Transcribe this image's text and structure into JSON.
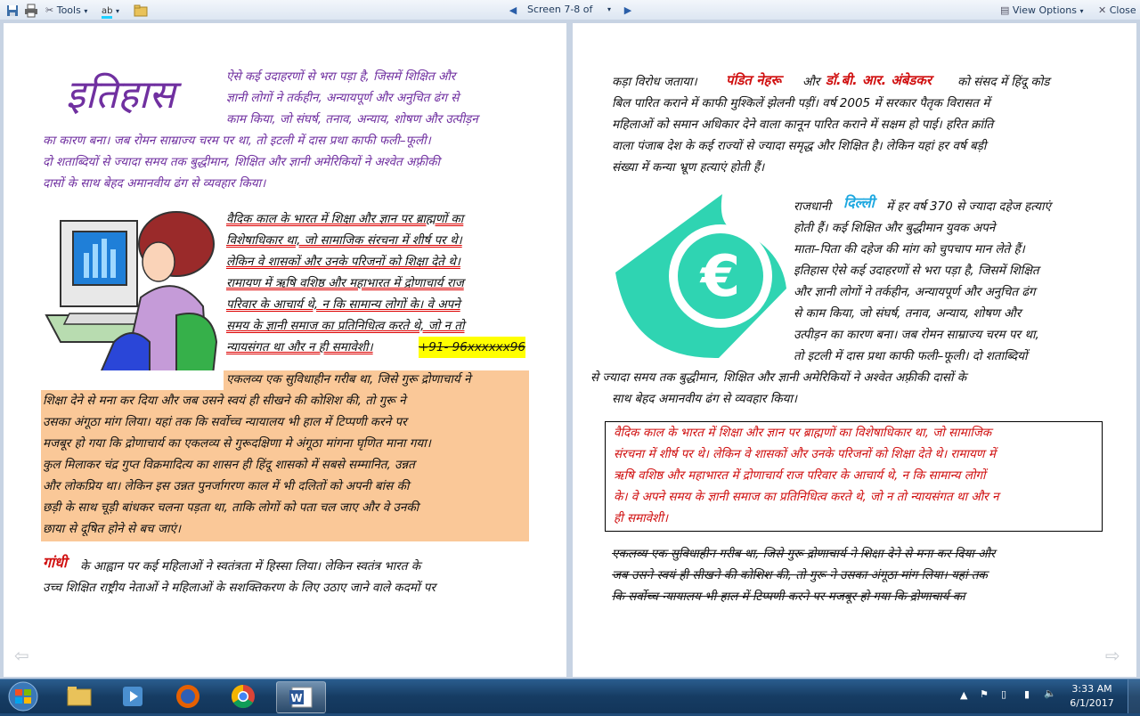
{
  "toolbar": {
    "tools_label": "Tools",
    "screen_label": "Screen 7-8 of 12",
    "view_options_label": "View Options",
    "close_label": "Close"
  },
  "left_page": {
    "title_word": "इतिहास",
    "intro_lines": [
      "ऐसे कई उदाहरणों से भरा पड़ा है, जिसमें शिक्षित और",
      "ज्ञानी लोगों ने तर्कहीन, अन्यायपूर्ण और अनुचित ढंग से",
      "काम किया, जो संघर्ष, तनाव, अन्याय, शोषण और उत्पीड़न",
      "का कारण बना। जब रोमन साम्राज्य चरम पर था, तो इटली में दास प्रथा काफी फली–फूली।",
      "दो शताब्दियों से ज्यादा समय तक बुद्धीमान, शिक्षित और ज्ञानी अमेरिकियों ने अश्वेत अफ़्रीकी",
      "दासों के साथ बेहद अमानवीय ढंग से व्यवहार किया।"
    ],
    "underlined_lines": [
      "वैदिक काल के भारत में शिक्षा और ज्ञान पर ब्राह्मणों का",
      "विशेषाधिकार था, जो सामाजिक संरचना में शीर्ष पर थे।",
      "लेकिन वे शासकों और उनके परिजनों को शिक्षा देते थे।",
      "रामायण में ऋषि वशिष्ठ और महाभारत में द्रोणाचार्य राज",
      "परिवार के आचार्य थे, न कि सामान्य लोगों के। वे अपने",
      "समय के ज्ञानी समाज का प्रतिनिधित्व करते थे, जो न तो",
      "न्यायसंगत था और न ही समावेशी।"
    ],
    "phone_highlight": "+91- 96xxxxxx96",
    "orange_lines": [
      "एकलव्य एक सुविधाहीन गरीब था, जिसे गुरू द्रोणाचार्य ने",
      "शिक्षा देने से मना कर दिया और जब उसने स्वयं ही सीखने की कोशिश की, तो गुरू ने",
      "उसका अंगूठा मांग लिया। यहां तक कि सर्वोच्च न्यायालय भी हाल में टिप्पणी करने पर",
      "मजबूर हो गया कि द्रोणाचार्य का एकलव्य से गुरूदक्षिणा मे अंगूठा मांगना घृणित माना गया।",
      "कुल मिलाकर चंद्र गुप्त विक्रमादित्य का शासन ही हिंदू शासको में सबसे सम्मानित, उन्नत",
      "और लोकप्रिय था। लेकिन इस उन्नत पुनर्जागरण काल में भी दलितों को अपनी बांस की",
      "छड़ी के साथ चूड़ी बांधकर चलना पड़ता था, ताकि लोगों को पता चल जाए और वे उनकी",
      "छाया से दूषित होने से बच जाएं।"
    ],
    "gandhi_word": "गांधी",
    "gandhi_line1": "के आह्वान पर कई महिलाओं ने स्वतंत्रता में हिस्सा लिया। लेकिन स्वतंत्र भारत के",
    "gandhi_line2": "उच्च शिक्षित राष्ट्रीय नेताओं ने महिलाओं के सशक्तिकरण के लिए उठाए जाने वाले कदमों पर"
  },
  "right_page": {
    "top_line1_a": "कड़ा विरोध जताया।",
    "nehru": "पंडित नेहरू",
    "aur": "और",
    "ambedkar": "डॉ.बी. आर. अंबेडकर",
    "top_line1_b": "को संसद में हिंदू कोड",
    "top_lines": [
      "बिल पारित कराने में काफी मुश्किलें झेलनी पड़ीं। वर्ष 2005 में सरकार पैतृक विरासत में",
      "महिलाओं को समान अधिकार देने वाला कानून पारित कराने में सक्षम हो पाई। हरित क्रांति",
      "वाला पंजाब देश के कई राज्यों से ज्यादा समृद्ध और शिक्षित है। लेकिन यहां हर वर्ष बड़ी",
      "संख्या में कन्या भ्रूण हत्याएं होती हैं।"
    ],
    "rajdhani": "राजधानी",
    "delhi": "दिल्ली",
    "delhi_rest": "में हर वर्ष 370 से ज्यादा दहेज हत्याएं",
    "wrap_lines": [
      "होती हैं। कई शिक्षित और बुद्धीमान युवक अपने",
      "माता–पिता की दहेज की मांग को चुपचाप मान लेते हैं।",
      "इतिहास ऐसे कई उदाहरणों से भरा पड़ा है, जिसमें शिक्षित",
      "और ज्ञानी लोगों ने तर्कहीन, अन्यायपूर्ण और अनुचित ढंग",
      "से काम किया, जो संघर्ष, तनाव, अन्याय, शोषण और",
      "उत्पीड़न का कारण बना। जब रोमन साम्राज्य चरम पर था,",
      "तो इटली में दास प्रथा काफी फली–फूली। दो शताब्दियों"
    ],
    "after_wrap_lines": [
      "से ज्यादा समय तक बुद्धीमान, शिक्षित और ज्ञानी अमेरिकियों ने अश्वेत अफ़्रीकी दासों के",
      "साथ बेहद अमानवीय ढंग से व्यवहार किया।"
    ],
    "boxed_lines": [
      "वैदिक काल के भारत में शिक्षा और ज्ञान पर ब्राह्मणों का विशेषाधिकार था, जो सामाजिक",
      "संरचना में शीर्ष पर थे। लेकिन वे शासकों और उनके परिजनों को शिक्षा देते थे। रामायण में",
      "ऋषि वशिष्ठ और महाभारत में द्रोणाचार्य राज परिवार के आचार्य थे, न कि सामान्य लोगों",
      "के। वे अपने समय के ज्ञानी समाज का प्रतिनिधित्व करते थे, जो न तो न्यायसंगत था और न",
      "ही समावेशी।"
    ],
    "strike_lines": [
      "एकलव्य एक सुविधाहीन गरीब था, जिसे गुरू द्रोणाचार्य ने शिक्षा देने से मना कर दिया और",
      "जब उसने स्वयं ही सीखने की कोशिश की, तो गुरू ने उसका अंगूठा मांग लिया। यहां तक",
      "कि सर्वोच्च न्यायालय भी हाल में टिप्पणी करने पर मजबूर हो गया कि द्रोणाचार्य का"
    ]
  },
  "taskbar": {
    "time": "3:33 AM",
    "date": "6/1/2017"
  },
  "colors": {
    "purple": "#7030a0",
    "red": "#d01010",
    "teal": "#2fd4b2",
    "orange_bg": "#fac898",
    "highlight": "#ffff00"
  }
}
